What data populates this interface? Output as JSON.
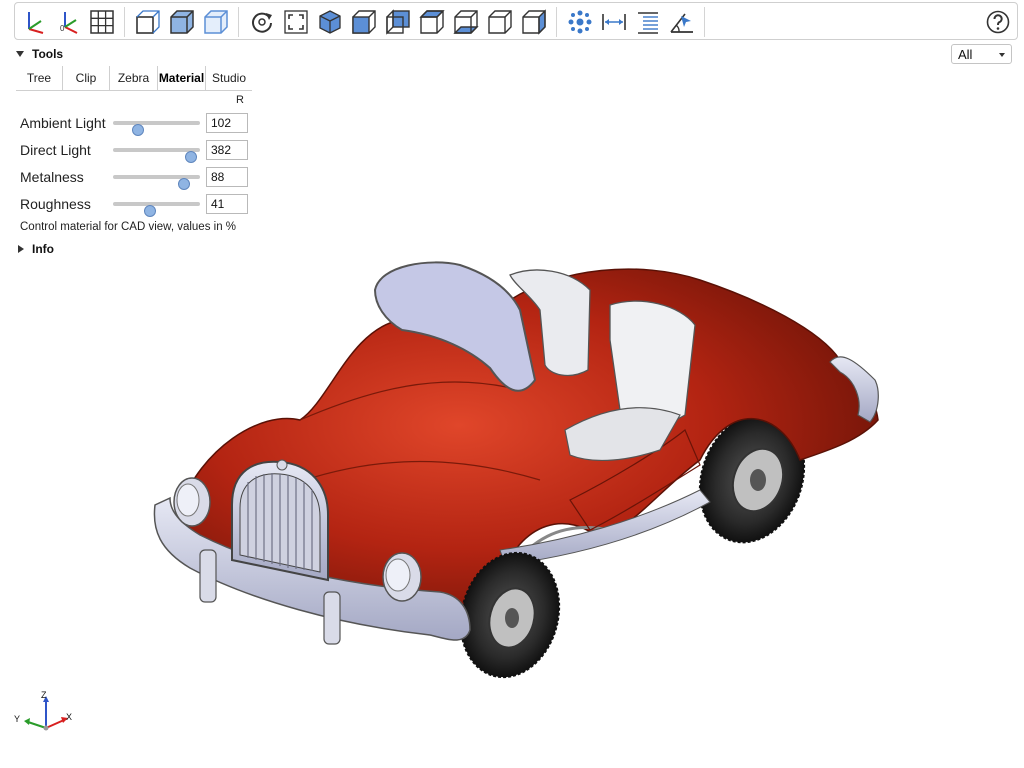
{
  "toolbar": {
    "buttons": [
      {
        "name": "axes-icon"
      },
      {
        "name": "axes-origin-icon"
      },
      {
        "name": "grid-icon"
      },
      {
        "name": "transparent-icon"
      },
      {
        "name": "black-edges-icon"
      },
      {
        "name": "perspective-icon"
      },
      {
        "name": "reset-view-icon"
      },
      {
        "name": "fit-view-icon"
      },
      {
        "name": "iso-view-icon"
      },
      {
        "name": "front-view-icon"
      },
      {
        "name": "back-view-icon"
      },
      {
        "name": "top-view-icon"
      },
      {
        "name": "bottom-view-icon"
      },
      {
        "name": "left-view-icon"
      },
      {
        "name": "right-view-icon"
      },
      {
        "name": "explode-icon"
      },
      {
        "name": "measure-distance-icon"
      },
      {
        "name": "properties-icon"
      },
      {
        "name": "measure-angle-icon"
      },
      {
        "name": "help-icon"
      }
    ]
  },
  "panel": {
    "title": "Tools",
    "tabs": [
      "Tree",
      "Clip",
      "Zebra",
      "Material",
      "Studio"
    ],
    "active_tab": "Material",
    "reset_label": "R",
    "sliders": [
      {
        "label": "Ambient Light",
        "value": "102",
        "fraction": 0.29
      },
      {
        "label": "Direct Light",
        "value": "382",
        "fraction": 0.9
      },
      {
        "label": "Metalness",
        "value": "88",
        "fraction": 0.82
      },
      {
        "label": "Roughness",
        "value": "41",
        "fraction": 0.42
      }
    ],
    "hint": "Control material for CAD view, values in %",
    "info_label": "Info"
  },
  "view_select": {
    "value": "All"
  },
  "axes_gizmo": {
    "x": "X",
    "y": "Y",
    "z": "Z"
  },
  "colors": {
    "accent": "#3a78c9",
    "car_body": "#b32412",
    "chrome": "#c6c9dc",
    "seats": "#e6e7ea",
    "tire": "#262626"
  }
}
